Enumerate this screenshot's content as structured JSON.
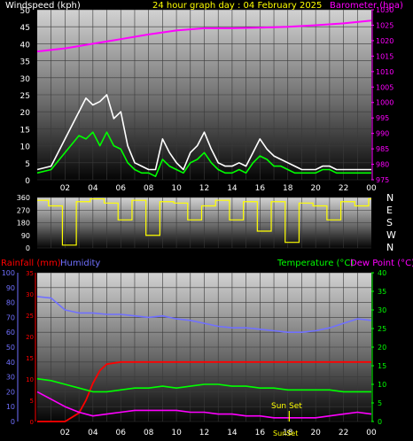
{
  "top": {
    "windspeed_label": "Windspeed (kph)",
    "title": "24 hour graph day : 04 February 2025",
    "barometer_label": "Barometer (hpa)",
    "colors": {
      "windspeed_label": "#ffffff",
      "title": "#ffff00",
      "barometer_label": "#ff00ff",
      "wind": "#ffffff",
      "gust": "#00ff00",
      "baro": "#ff00ff"
    }
  },
  "middle": {
    "dir_letters": [
      "N",
      "W",
      "S",
      "E",
      "N"
    ],
    "colors": {
      "direction": "#ffff00"
    }
  },
  "bottom": {
    "rainfall_label": "Rainfall (mm)",
    "humidity_label": "Humidity",
    "temperature_label": "Temperature (°C)",
    "dewpoint_label": "Dew Point (°C)",
    "sunset_label": "Sun Set",
    "sunset_axis_label": "SunSet",
    "colors": {
      "rainfall": "#ff0000",
      "humidity": "#7070ff",
      "temperature": "#00ff00",
      "dewpoint": "#ff00ff",
      "sunset": "#ffff00"
    }
  },
  "chart_data": [
    {
      "type": "line",
      "title": "24 hour graph day : 04 February 2025",
      "xlabel": "",
      "x_ticks": [
        "02",
        "04",
        "06",
        "08",
        "10",
        "12",
        "14",
        "16",
        "18",
        "20",
        "22",
        "00"
      ],
      "xlim": [
        0,
        24
      ],
      "y_left": {
        "label": "Windspeed (kph)",
        "lim": [
          0,
          50
        ],
        "ticks": [
          0,
          5,
          10,
          15,
          20,
          25,
          30,
          35,
          40,
          45,
          50
        ]
      },
      "y_right": {
        "label": "Barometer (hpa)",
        "lim": [
          975,
          1030
        ],
        "ticks": [
          975,
          980,
          985,
          990,
          995,
          1000,
          1005,
          1010,
          1015,
          1020,
          1025,
          1030
        ]
      },
      "series": [
        {
          "name": "Windspeed (kph)",
          "axis": "left",
          "x": [
            0,
            1,
            2,
            3,
            3.5,
            4,
            4.5,
            5,
            5.5,
            6,
            6.5,
            7,
            7.5,
            8,
            8.5,
            9,
            9.5,
            10,
            10.5,
            11,
            11.5,
            12,
            12.5,
            13,
            13.5,
            14,
            14.5,
            15,
            15.5,
            16,
            16.5,
            17,
            17.5,
            18,
            18.5,
            19,
            19.5,
            20,
            20.5,
            21,
            21.5,
            22,
            22.5,
            23,
            24
          ],
          "y": [
            3,
            4,
            12,
            20,
            24,
            22,
            23,
            25,
            18,
            20,
            10,
            5,
            4,
            3,
            3,
            12,
            8,
            5,
            3,
            8,
            10,
            14,
            9,
            5,
            4,
            4,
            5,
            4,
            8,
            12,
            9,
            7,
            6,
            5,
            4,
            3,
            3,
            3,
            4,
            4,
            3,
            3,
            3,
            3,
            3
          ]
        },
        {
          "name": "Gust",
          "axis": "left",
          "x": [
            0,
            1,
            2,
            3,
            3.5,
            4,
            4.5,
            5,
            5.5,
            6,
            6.5,
            7,
            7.5,
            8,
            8.5,
            9,
            9.5,
            10,
            10.5,
            11,
            11.5,
            12,
            12.5,
            13,
            13.5,
            14,
            14.5,
            15,
            15.5,
            16,
            16.5,
            17,
            17.5,
            18,
            18.5,
            19,
            19.5,
            20,
            20.5,
            21,
            21.5,
            22,
            22.5,
            23,
            24
          ],
          "y": [
            2,
            3,
            8,
            13,
            12,
            14,
            10,
            14,
            10,
            9,
            5,
            3,
            2,
            2,
            1,
            6,
            4,
            3,
            2,
            5,
            6,
            8,
            5,
            3,
            2,
            2,
            3,
            2,
            5,
            7,
            6,
            4,
            4,
            3,
            2,
            2,
            2,
            2,
            3,
            3,
            2,
            2,
            2,
            2,
            2
          ]
        },
        {
          "name": "Barometer (hpa)",
          "axis": "right",
          "x": [
            0,
            2,
            4,
            6,
            8,
            10,
            12,
            14,
            16,
            18,
            20,
            22,
            24
          ],
          "y": [
            1016.5,
            1017.5,
            1019,
            1020.5,
            1022,
            1023.3,
            1024,
            1024,
            1024.2,
            1024.5,
            1025,
            1025.6,
            1026.5
          ]
        }
      ]
    },
    {
      "type": "line",
      "title": "",
      "xlim": [
        0,
        24
      ],
      "y_left": {
        "lim": [
          0,
          360
        ],
        "ticks": [
          0,
          90,
          180,
          270,
          360
        ]
      },
      "y_right": {
        "labels": [
          "N",
          "W",
          "S",
          "E",
          "N"
        ]
      },
      "series": [
        {
          "name": "Wind Direction",
          "x": [
            0,
            1,
            2,
            3,
            4,
            5,
            6,
            7,
            8,
            9,
            10,
            11,
            12,
            13,
            14,
            15,
            16,
            17,
            18,
            19,
            20,
            21,
            22,
            23,
            24
          ],
          "y": [
            340,
            300,
            20,
            330,
            350,
            320,
            200,
            340,
            90,
            330,
            320,
            200,
            300,
            340,
            200,
            330,
            120,
            330,
            40,
            320,
            300,
            200,
            330,
            300,
            350
          ]
        }
      ]
    },
    {
      "type": "line",
      "title": "",
      "xlim": [
        0,
        24
      ],
      "x_ticks": [
        "02",
        "04",
        "06",
        "08",
        "10",
        "12",
        "14",
        "16",
        "18",
        "20",
        "22",
        "00"
      ],
      "y_axes": [
        {
          "label": "Humidity",
          "lim": [
            0,
            100
          ],
          "ticks": [
            0,
            10,
            20,
            30,
            40,
            50,
            60,
            70,
            80,
            90,
            100
          ]
        },
        {
          "label": "Rainfall (mm)",
          "lim": [
            0,
            35
          ],
          "ticks": [
            0,
            5,
            10,
            15,
            20,
            25,
            30,
            35
          ]
        },
        {
          "label": "Temperature (°C) / Dew Point (°C)",
          "lim": [
            0,
            40
          ],
          "ticks": [
            0,
            5,
            10,
            15,
            20,
            25,
            30,
            35,
            40
          ]
        }
      ],
      "series": [
        {
          "name": "Humidity",
          "axis": "humidity",
          "x": [
            0,
            1,
            2,
            3,
            4,
            5,
            6,
            7,
            8,
            9,
            10,
            11,
            12,
            13,
            14,
            15,
            16,
            17,
            18,
            19,
            20,
            21,
            22,
            23,
            24
          ],
          "y": [
            84,
            83,
            75,
            73,
            73,
            72,
            72,
            71,
            70,
            71,
            69,
            68,
            66,
            64,
            63,
            63,
            62,
            61,
            60,
            60,
            61,
            63,
            66,
            69,
            68
          ]
        },
        {
          "name": "Rainfall (mm)",
          "axis": "rainfall",
          "x": [
            0,
            1,
            2,
            3,
            3.5,
            4,
            4.5,
            5,
            6,
            7,
            8,
            12,
            16,
            20,
            24
          ],
          "y": [
            0,
            0,
            0,
            2,
            5,
            9,
            12,
            13.5,
            14,
            14,
            14,
            14,
            14,
            14,
            14
          ]
        },
        {
          "name": "Temperature (°C)",
          "axis": "temperature",
          "x": [
            0,
            1,
            2,
            3,
            4,
            5,
            6,
            7,
            8,
            9,
            10,
            11,
            12,
            13,
            14,
            15,
            16,
            17,
            18,
            19,
            20,
            21,
            22,
            23,
            24
          ],
          "y": [
            11.5,
            11,
            10,
            9,
            8,
            8,
            8.5,
            9,
            9,
            9.5,
            9,
            9.5,
            10,
            10,
            9.5,
            9.5,
            9,
            9,
            8.5,
            8.5,
            8.5,
            8.5,
            8,
            8,
            8
          ]
        },
        {
          "name": "Dew Point (°C)",
          "axis": "temperature",
          "x": [
            0,
            1,
            2,
            3,
            4,
            5,
            6,
            7,
            8,
            9,
            10,
            11,
            12,
            13,
            14,
            15,
            16,
            17,
            18,
            19,
            20,
            21,
            22,
            23,
            24
          ],
          "y": [
            8,
            6,
            4,
            2.5,
            1.5,
            2,
            2.5,
            3,
            3,
            3,
            3,
            2.5,
            2.5,
            2,
            2,
            1.5,
            1.5,
            1,
            1,
            1,
            1,
            1.5,
            2,
            2.5,
            2
          ]
        }
      ],
      "annotations": [
        {
          "label": "Sun Set",
          "x": 18.1
        }
      ]
    }
  ]
}
